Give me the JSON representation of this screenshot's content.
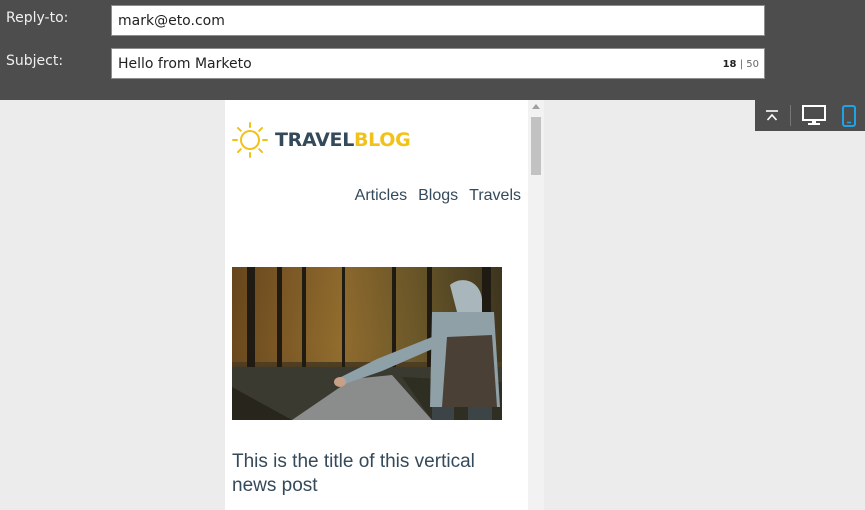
{
  "form": {
    "reply_to": {
      "label": "Reply-to:",
      "value": "mark@eto.com"
    },
    "subject": {
      "label": "Subject:",
      "value": "Hello from Marketo",
      "count": "18",
      "separator": "|",
      "max": "50"
    }
  },
  "email_preview": {
    "logo": {
      "part1": "TRAVEL",
      "part2": "BLOG"
    },
    "nav": [
      "Articles",
      "Blogs",
      "Travels"
    ],
    "post_title": "This is the title of this vertical news post"
  },
  "device_toolbar": {
    "buttons": [
      {
        "icon": "collapse-top-icon"
      },
      {
        "icon": "desktop-icon"
      },
      {
        "icon": "mobile-icon",
        "active": true
      }
    ],
    "active_color": "#1ea4e6"
  },
  "colors": {
    "logo_dark": "#34495a",
    "logo_accent": "#f3c21a"
  }
}
